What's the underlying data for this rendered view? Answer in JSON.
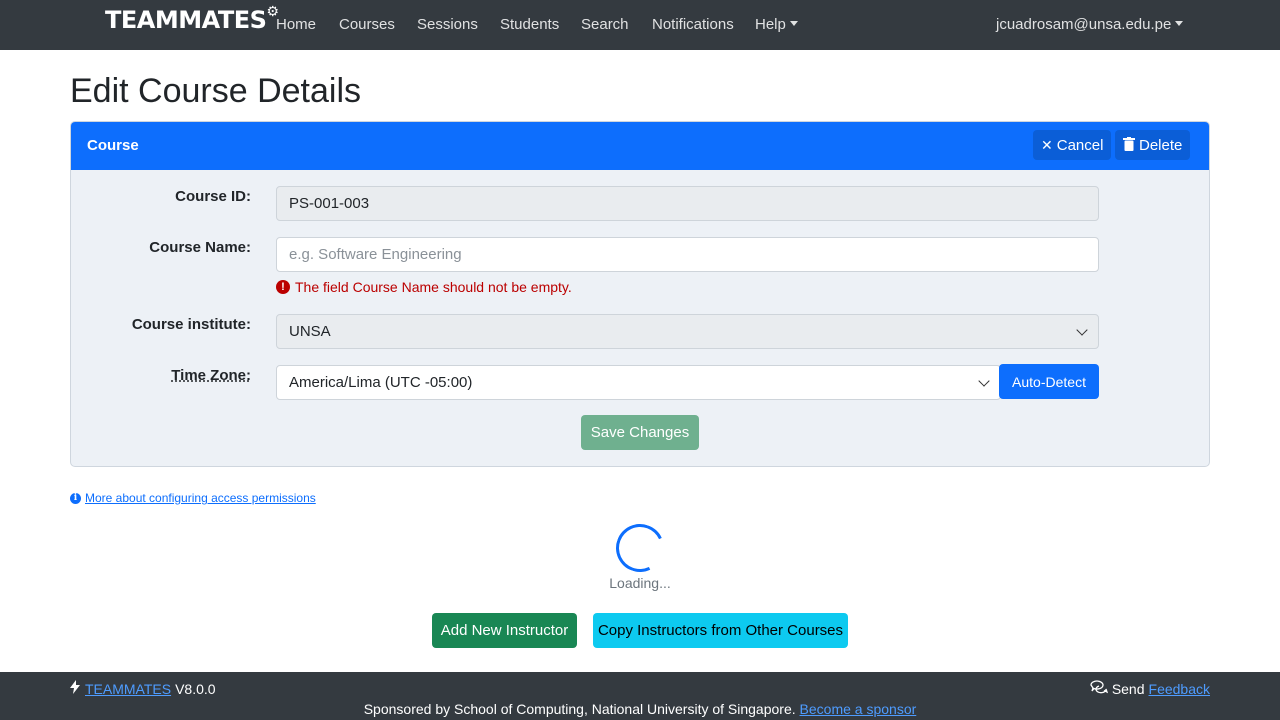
{
  "navbar": {
    "brand": "TEAMMATES",
    "links": [
      "Home",
      "Courses",
      "Sessions",
      "Students",
      "Search",
      "Notifications"
    ],
    "help": "Help",
    "user": "jcuadrosam@unsa.edu.pe"
  },
  "page": {
    "title": "Edit Course Details"
  },
  "card": {
    "header": "Course",
    "cancel": "Cancel",
    "delete": "Delete",
    "course_id_label": "Course ID:",
    "course_id_value": "PS-001-003",
    "course_name_label": "Course Name:",
    "course_name_placeholder": "e.g. Software Engineering",
    "course_name_error": "The field Course Name should not be empty.",
    "institute_label": "Course institute:",
    "institute_value": "UNSA",
    "timezone_label": "Time Zone:",
    "timezone_value": "America/Lima (UTC -05:00)",
    "auto_detect": "Auto-Detect",
    "save": "Save Changes"
  },
  "more_link": "More about configuring access permissions",
  "loading": "Loading...",
  "actions": {
    "add_instructor": "Add New Instructor",
    "copy_instructors": "Copy Instructors from Other Courses"
  },
  "footer": {
    "brand_link": "TEAMMATES",
    "version": "V8.0.0",
    "send": "Send",
    "feedback": "Feedback",
    "sponsor_text": "Sponsored by School of Computing, National University of Singapore.",
    "sponsor_link": "Become a sponsor"
  },
  "colors": {
    "primary": "#0d6efd",
    "navbar": "#343a40",
    "success": "#198754",
    "info": "#0dcaf0",
    "danger": "#bb0000"
  }
}
